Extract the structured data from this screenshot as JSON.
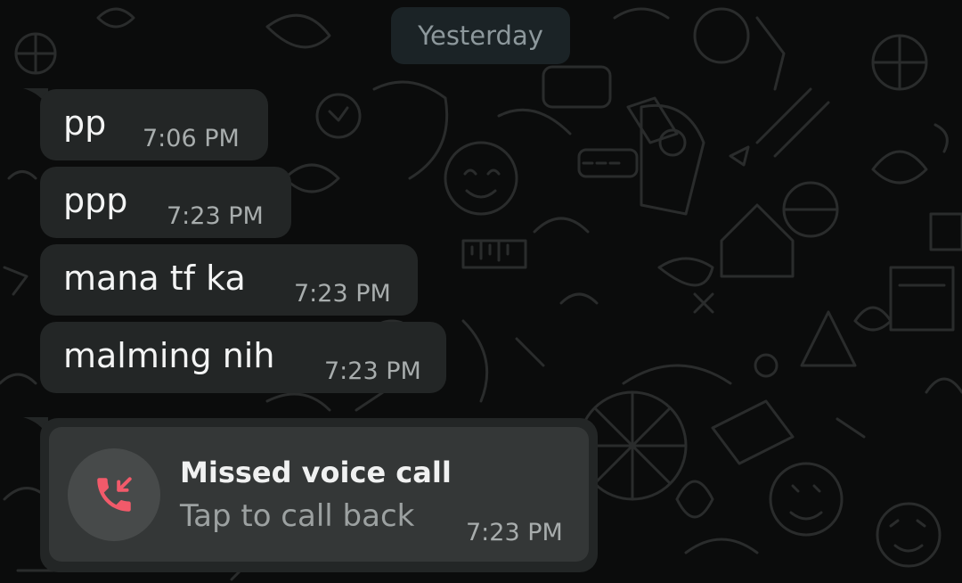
{
  "date_chip": "Yesterday",
  "messages": [
    {
      "text": "pp",
      "time": "7:06 PM"
    },
    {
      "text": "ppp",
      "time": "7:23 PM"
    },
    {
      "text": "mana tf ka",
      "time": "7:23 PM"
    },
    {
      "text": "malming nih",
      "time": "7:23 PM"
    }
  ],
  "missed_call": {
    "title": "Missed voice call",
    "subtitle": "Tap to call back",
    "time": "7:23 PM",
    "icon": "missed-call-icon"
  },
  "colors": {
    "background": "#0b0c0c",
    "bubble": "#232626",
    "call_card": "#343737",
    "missed_call_red": "#f25a6a",
    "date_chip": "#1b2326"
  }
}
